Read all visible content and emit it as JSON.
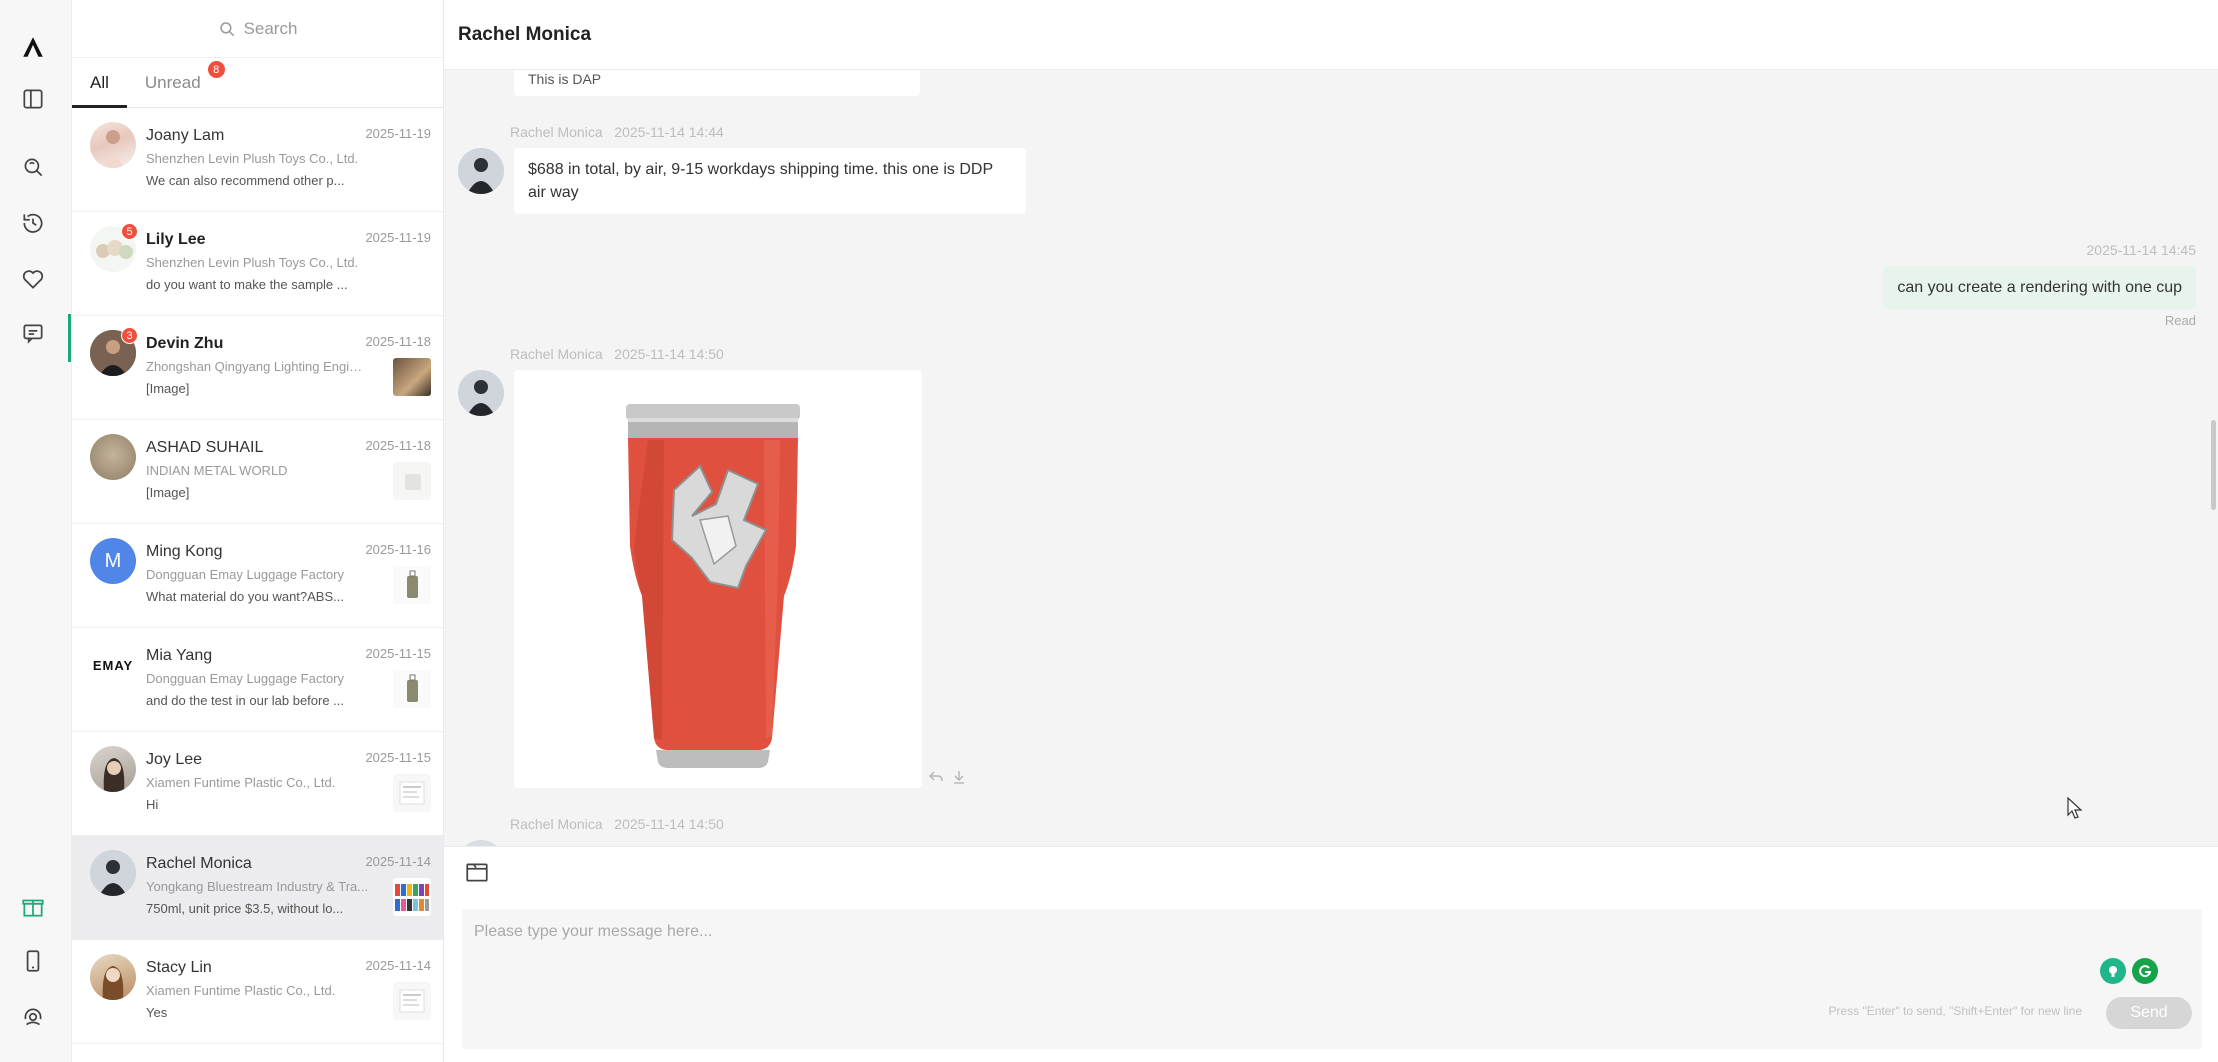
{
  "rail": {
    "logo": "A-logo-icon",
    "icons": [
      "sidebar-panel-icon",
      "search-refresh-icon",
      "history-icon",
      "heart-icon",
      "message-icon",
      "gift-icon",
      "phone-icon",
      "headset-support-icon"
    ]
  },
  "list": {
    "search_label": "Search",
    "tabs": [
      {
        "label": "All",
        "active": true
      },
      {
        "label": "Unread",
        "badge": "8"
      }
    ],
    "conversations": [
      {
        "name": "Joany Lam",
        "date": "2025-11-19",
        "company": "Shenzhen Levin Plush Toys Co., Ltd.",
        "snippet": "We can also recommend other p...",
        "bold": false,
        "badge": ""
      },
      {
        "name": "Lily Lee",
        "date": "2025-11-19",
        "company": "Shenzhen Levin Plush Toys Co., Ltd.",
        "snippet": "do you want to make the sample ...",
        "bold": true,
        "badge": "5"
      },
      {
        "name": "Devin Zhu",
        "date": "2025-11-18",
        "company": "Zhongshan Qingyang Lighting Engin...",
        "snippet": "[Image]",
        "bold": true,
        "badge": "3"
      },
      {
        "name": "ASHAD SUHAIL",
        "date": "2025-11-18",
        "company": "INDIAN METAL WORLD",
        "snippet": "[Image]",
        "bold": false,
        "badge": ""
      },
      {
        "name": "Ming Kong",
        "date": "2025-11-16",
        "company": "Dongguan Emay Luggage Factory",
        "snippet": "What material do you want?ABS...",
        "bold": false,
        "badge": "",
        "initial": "M"
      },
      {
        "name": "Mia Yang",
        "date": "2025-11-15",
        "company": "Dongguan Emay Luggage Factory",
        "snippet": "and do the test in our lab before ...",
        "bold": false,
        "badge": "",
        "logo_text": "EMAY"
      },
      {
        "name": "Joy Lee",
        "date": "2025-11-15",
        "company": "Xiamen Funtime Plastic Co., Ltd.",
        "snippet": "Hi",
        "bold": false,
        "badge": ""
      },
      {
        "name": "Rachel Monica",
        "date": "2025-11-14",
        "company": "Yongkang Bluestream Industry & Tra...",
        "snippet": "750ml, unit price $3.5, without lo...",
        "bold": false,
        "badge": "",
        "selected": true
      },
      {
        "name": "Stacy Lin",
        "date": "2025-11-14",
        "company": "Xiamen Funtime Plastic Co., Ltd.",
        "snippet": "Yes",
        "bold": false,
        "badge": ""
      }
    ]
  },
  "chat": {
    "title": "Rachel Monica",
    "messages": {
      "clipped_top_text": "This is DAP",
      "m1_sender": "Rachel Monica",
      "m1_time": "2025-11-14 14:44",
      "m1_text": "$688 in total, by air, 9-15 workdays shipping time. this one is DDP air way",
      "m2_time": "2025-11-14 14:45",
      "m2_text": "can you create a rendering with one cup",
      "m2_status": "Read",
      "m3_sender": "Rachel Monica",
      "m3_time": "2025-11-14 14:50",
      "m3_image": "red-tumbler-cup-image",
      "m4_sender": "Rachel Monica",
      "m4_time": "2025-11-14 14:50"
    },
    "composer": {
      "placeholder": "Please type your message here...",
      "hint": "Press \"Enter\" to send, \"Shift+Enter\" for new line",
      "send_label": "Send"
    },
    "colors": {
      "accent": "#1aa97a",
      "badge": "#ef4f3d",
      "own_bubble": "#e7f4ec",
      "cup_red": "#e0503f"
    }
  }
}
